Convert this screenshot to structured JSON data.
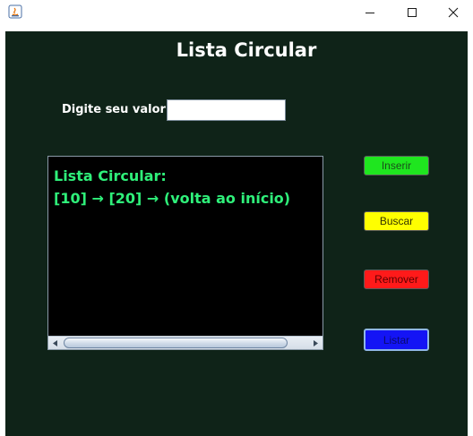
{
  "window": {
    "icons": {
      "app": "java-icon",
      "minimize": "minimize-icon",
      "maximize": "maximize-icon",
      "close": "close-icon"
    }
  },
  "main": {
    "title": "Lista Circular",
    "input_label": "Digite seu valor:",
    "input_value": "",
    "display_lines": "Lista Circular:\n[10] → [20] → (volta ao início)"
  },
  "buttons": {
    "inserir": "Inserir",
    "buscar": "Buscar",
    "remover": "Remover",
    "listar": "Listar"
  },
  "colors": {
    "background": "#0f2318",
    "display_text": "#2ff07a",
    "inserir": "#1fe61f",
    "buscar": "#ffff00",
    "remover": "#ff1a1a",
    "listar": "#1414f5"
  }
}
